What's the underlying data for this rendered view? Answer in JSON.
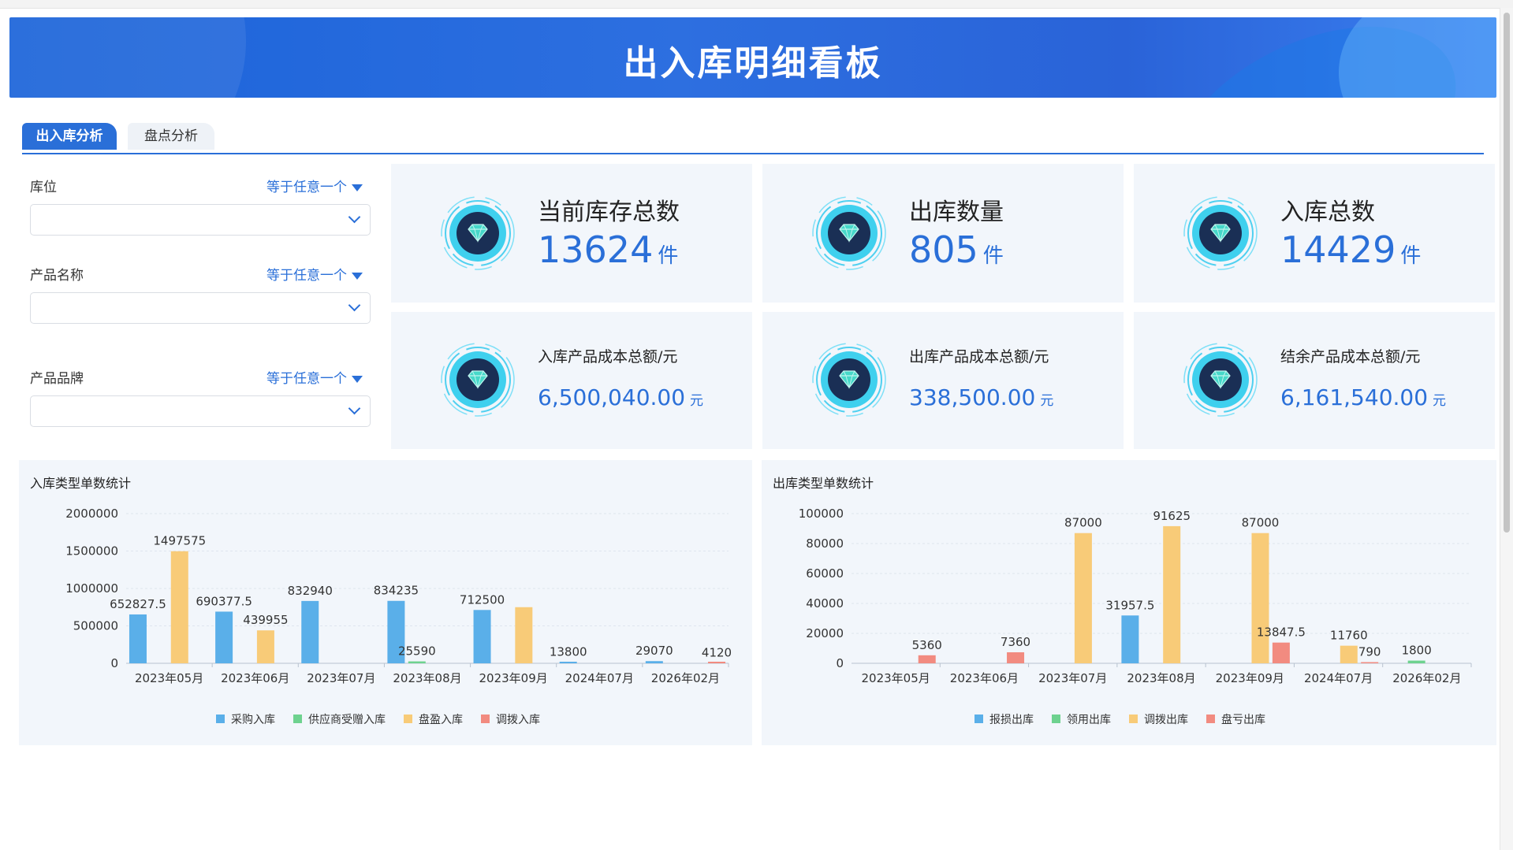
{
  "header": {
    "title": "出入库明细看板"
  },
  "tabs": [
    {
      "label": "出入库分析",
      "active": true
    },
    {
      "label": "盘点分析",
      "active": false
    }
  ],
  "filters": [
    {
      "label": "库位",
      "operator": "等于任意一个",
      "value": ""
    },
    {
      "label": "产品名称",
      "operator": "等于任意一个",
      "value": ""
    },
    {
      "label": "产品品牌",
      "operator": "等于任意一个",
      "value": ""
    }
  ],
  "kpis": [
    {
      "title": "当前库存总数",
      "value": "13624",
      "unit": "件",
      "icon": "diamond-icon"
    },
    {
      "title": "出库数量",
      "value": "805",
      "unit": "件",
      "icon": "diamond-icon"
    },
    {
      "title": "入库总数",
      "value": "14429",
      "unit": "件",
      "icon": "diamond-icon"
    },
    {
      "title": "入库产品成本总额/元",
      "value": "6,500,040.00",
      "unit": "元",
      "icon": "diamond-icon"
    },
    {
      "title": "出库产品成本总额/元",
      "value": "338,500.00",
      "unit": "元",
      "icon": "diamond-icon"
    },
    {
      "title": "结余产品成本总额/元",
      "value": "6,161,540.00",
      "unit": "元",
      "icon": "diamond-icon"
    }
  ],
  "colors": {
    "blue": "#5aafe9",
    "green": "#6ed28f",
    "yellow": "#f8cb78",
    "red": "#f28b80",
    "accent": "#2a6fd8"
  },
  "chart_data": [
    {
      "type": "bar",
      "title": "入库类型单数统计",
      "categories": [
        "2023年05月",
        "2023年06月",
        "2023年07月",
        "2023年08月",
        "2023年09月",
        "2024年07月",
        "2026年02月"
      ],
      "ylim": [
        0,
        2000000
      ],
      "yticks": [
        0,
        500000,
        1000000,
        1500000,
        2000000
      ],
      "grid": true,
      "legend_position": "bottom",
      "series": [
        {
          "name": "采购入库",
          "color": "#5aafe9",
          "values": [
            652827.5,
            690377.5,
            832940,
            834235,
            712500,
            13800,
            29070
          ]
        },
        {
          "name": "供应商受赠入库",
          "color": "#6ed28f",
          "values": [
            null,
            null,
            null,
            25590,
            null,
            null,
            null
          ]
        },
        {
          "name": "盘盈入库",
          "color": "#f8cb78",
          "values": [
            1497575,
            439955,
            null,
            null,
            750000,
            null,
            null
          ]
        },
        {
          "name": "调拨入库",
          "color": "#f28b80",
          "values": [
            null,
            null,
            null,
            null,
            null,
            null,
            4120
          ]
        }
      ],
      "data_labels": [
        {
          "series": 0,
          "index": 0,
          "text": "652827.5"
        },
        {
          "series": 2,
          "index": 0,
          "text": "1497575"
        },
        {
          "series": 0,
          "index": 1,
          "text": "690377.5"
        },
        {
          "series": 2,
          "index": 1,
          "text": "439955"
        },
        {
          "series": 0,
          "index": 2,
          "text": "832940"
        },
        {
          "series": 0,
          "index": 3,
          "text": "834235"
        },
        {
          "series": 1,
          "index": 3,
          "text": "25590"
        },
        {
          "series": 0,
          "index": 4,
          "text": "712500"
        },
        {
          "series": 0,
          "index": 5,
          "text": "13800"
        },
        {
          "series": 0,
          "index": 6,
          "text": "29070"
        },
        {
          "series": 3,
          "index": 6,
          "text": "4120"
        }
      ]
    },
    {
      "type": "bar",
      "title": "出库类型单数统计",
      "categories": [
        "2023年05月",
        "2023年06月",
        "2023年07月",
        "2023年08月",
        "2023年09月",
        "2024年07月",
        "2026年02月"
      ],
      "ylim": [
        0,
        100000
      ],
      "yticks": [
        0,
        20000,
        40000,
        60000,
        80000,
        100000
      ],
      "grid": true,
      "legend_position": "bottom",
      "series": [
        {
          "name": "报损出库",
          "color": "#5aafe9",
          "values": [
            null,
            null,
            null,
            31957.5,
            null,
            null,
            null
          ]
        },
        {
          "name": "领用出库",
          "color": "#6ed28f",
          "values": [
            null,
            null,
            null,
            null,
            null,
            null,
            1800
          ]
        },
        {
          "name": "调拨出库",
          "color": "#f8cb78",
          "values": [
            null,
            null,
            87000,
            91625,
            87000,
            11760,
            null
          ]
        },
        {
          "name": "盘亏出库",
          "color": "#f28b80",
          "values": [
            5360,
            7360,
            null,
            null,
            13847.5,
            790,
            null
          ]
        }
      ],
      "data_labels": [
        {
          "series": 3,
          "index": 0,
          "text": "5360"
        },
        {
          "series": 3,
          "index": 1,
          "text": "7360"
        },
        {
          "series": 2,
          "index": 2,
          "text": "87000"
        },
        {
          "series": 0,
          "index": 3,
          "text": "31957.5"
        },
        {
          "series": 2,
          "index": 3,
          "text": "91625"
        },
        {
          "series": 2,
          "index": 4,
          "text": "87000"
        },
        {
          "series": 3,
          "index": 4,
          "text": "13847.5"
        },
        {
          "series": 2,
          "index": 5,
          "text": "11760"
        },
        {
          "series": 3,
          "index": 5,
          "text": "790"
        },
        {
          "series": 1,
          "index": 6,
          "text": "1800"
        }
      ]
    }
  ]
}
